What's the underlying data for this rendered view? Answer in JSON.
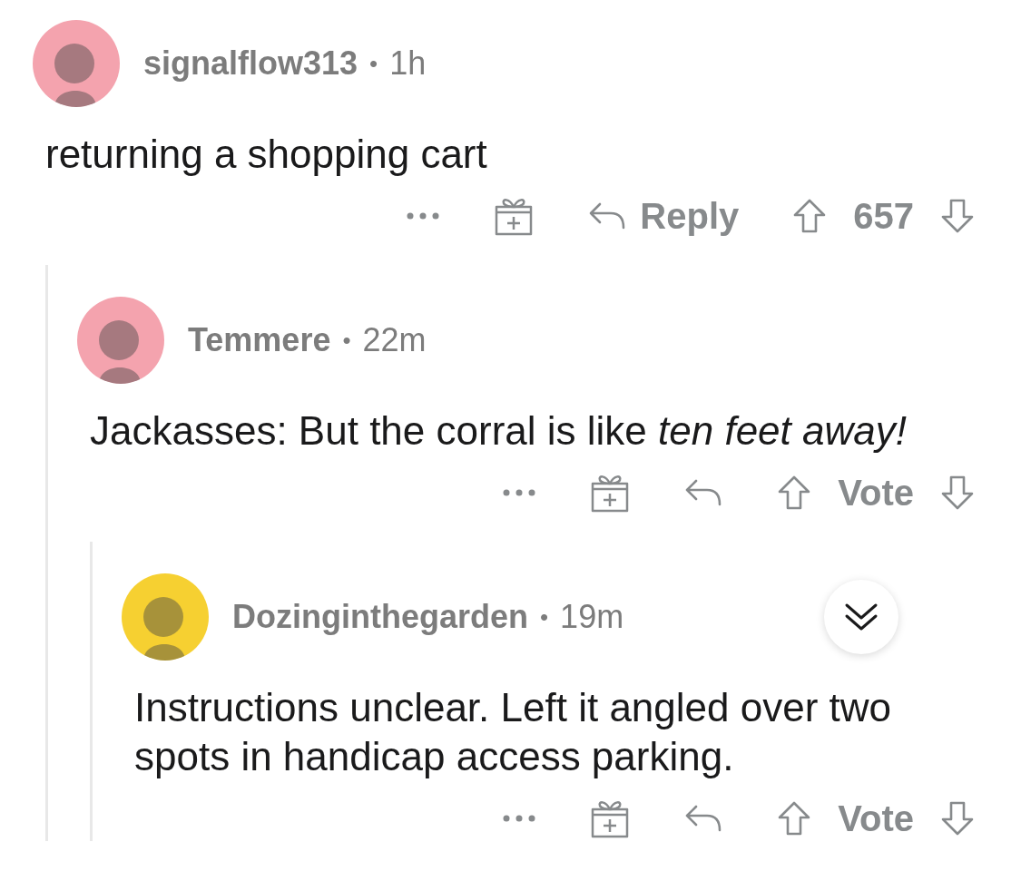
{
  "comments": [
    {
      "username": "signalflow313",
      "separator": "•",
      "time": "1h",
      "color": "#f4a3ae",
      "body": "returning a shopping cart",
      "reply_label": "Reply",
      "score": "657",
      "children": [
        {
          "username": "Temmere",
          "separator": "•",
          "time": "22m",
          "color": "#f4a3ae",
          "body": "Jackasses: But the corral is like *ten feet away!*",
          "score": "Vote",
          "children": [
            {
              "username": "Dozinginthegarden",
              "separator": "•",
              "time": "19m",
              "color": "#f6d031",
              "body": "Instructions unclear. Left it angled over two spots in handicap access parking.",
              "collapsible": true,
              "score": "Vote"
            }
          ]
        }
      ]
    }
  ]
}
